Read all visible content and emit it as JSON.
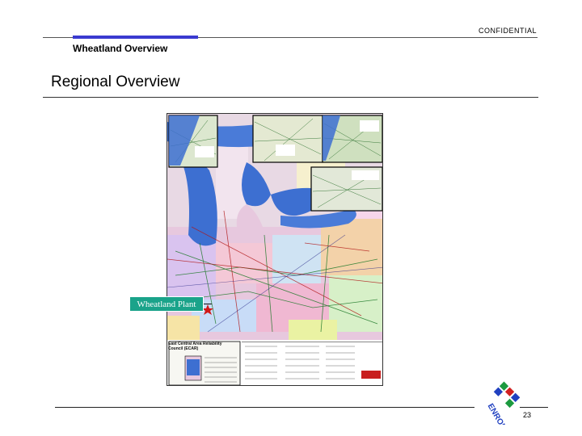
{
  "header": {
    "confidential": "CONFIDENTIAL",
    "section": "Wheatland Overview"
  },
  "page": {
    "title": "Regional Overview",
    "number": "23"
  },
  "map": {
    "insets": [
      "Chicago Detail",
      "Detroit Detail",
      "Pittsburgh Detail",
      "Cincinnati Detail"
    ],
    "legend_title": "East Central Area Reliability Council (ECAR)",
    "plant_callout": "Wheatland Plant"
  },
  "logo": {
    "text": "ENRON"
  },
  "colors": {
    "accent_bar": "#3a3ad0",
    "callout_bg": "#1aa38a",
    "water": "#3d6fd1",
    "logo_green": "#1c9a3f",
    "logo_blue": "#2040c0",
    "logo_red": "#d12020"
  }
}
